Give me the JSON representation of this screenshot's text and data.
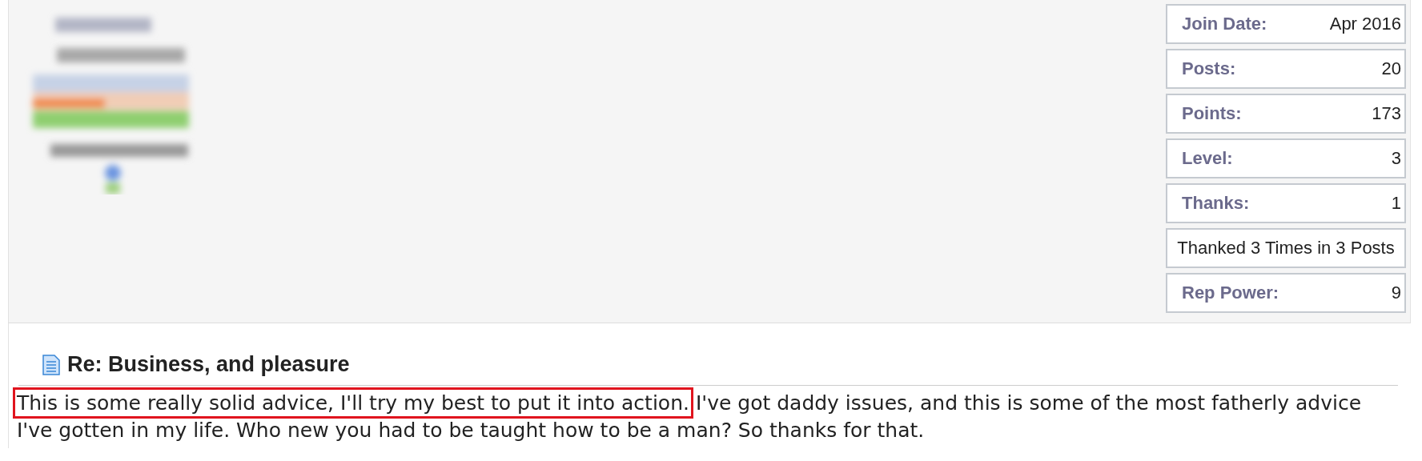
{
  "user_stats": [
    {
      "kind": "pair",
      "label": "Join Date:",
      "value": "Apr 2016"
    },
    {
      "kind": "pair",
      "label": "Posts:",
      "value": "20"
    },
    {
      "kind": "pair",
      "label": "Points:",
      "value": "173"
    },
    {
      "kind": "pair",
      "label": "Level:",
      "value": "3"
    },
    {
      "kind": "pair",
      "label": "Thanks:",
      "value": "1"
    },
    {
      "kind": "note",
      "value": "Thanked 3 Times in 3 Posts"
    },
    {
      "kind": "pair",
      "label": "Rep Power:",
      "value": "9"
    }
  ],
  "post": {
    "title": "Re: Business, and pleasure",
    "body": [
      {
        "text": "This is some really solid advice, I'll try my best to put it into action.",
        "highlighted": true
      },
      {
        "text": " I've got daddy issues, and this is some of the most fatherly advice I've gotten in my life. Who new you had to be taught how to be a man? So thanks for that.",
        "highlighted": false
      }
    ]
  }
}
